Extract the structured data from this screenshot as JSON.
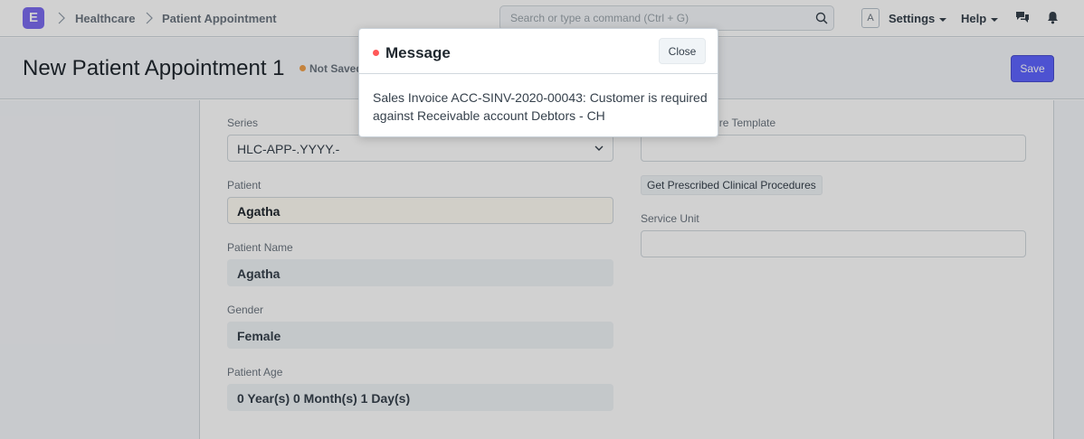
{
  "navbar": {
    "logo_letter": "E",
    "breadcrumbs": [
      "Healthcare",
      "Patient Appointment"
    ],
    "search_placeholder": "Search or type a command (Ctrl + G)",
    "avatar_letter": "A",
    "settings_label": "Settings",
    "help_label": "Help"
  },
  "page": {
    "title": "New Patient Appointment 1",
    "status": "Not Saved",
    "save_label": "Save"
  },
  "form": {
    "series": {
      "label": "Series",
      "value": "HLC-APP-.YYYY.-"
    },
    "procedure_template": {
      "label": "Clinical Procedure Template",
      "value": ""
    },
    "prescribed_procedures_button": "Get Prescribed Clinical Procedures",
    "service_unit": {
      "label": "Service Unit",
      "value": ""
    },
    "patient": {
      "label": "Patient",
      "value": "Agatha"
    },
    "patient_name": {
      "label": "Patient Name",
      "value": "Agatha"
    },
    "gender": {
      "label": "Gender",
      "value": "Female"
    },
    "patient_age": {
      "label": "Patient Age",
      "value": "0 Year(s) 0 Month(s) 1 Day(s)"
    }
  },
  "dialog": {
    "title": "Message",
    "close_label": "Close",
    "message": "Sales Invoice ACC-SINV-2020-00043: Customer is required against Receivable account Debtors - CH"
  },
  "colors": {
    "brand": "#7c6cf0",
    "primary_button": "#5e64ff",
    "indicator_unsaved": "#f0a04b",
    "indicator_error": "#ff5858"
  }
}
